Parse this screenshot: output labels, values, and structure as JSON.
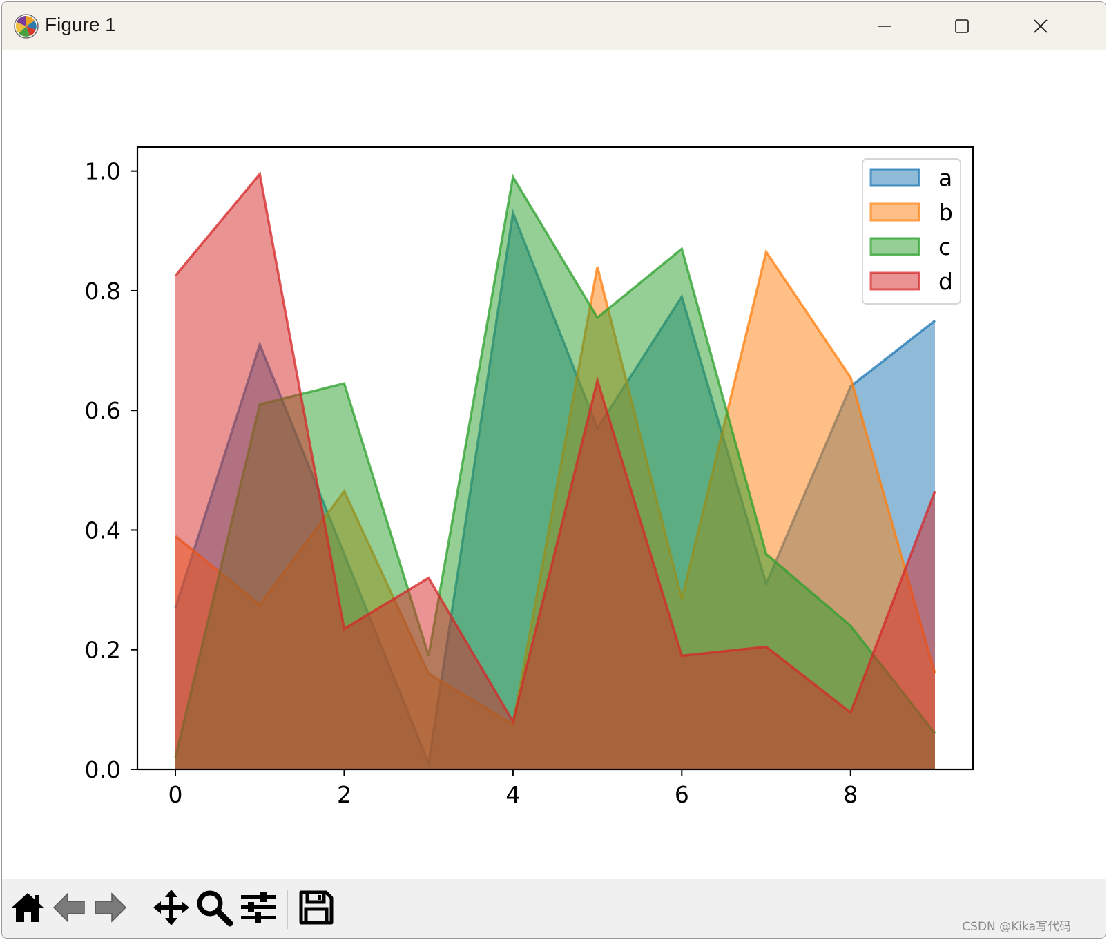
{
  "window": {
    "title": "Figure 1",
    "icons": [
      "matplotlib-icon",
      "minimize-icon",
      "maximize-icon",
      "close-icon"
    ]
  },
  "toolbar": {
    "buttons": [
      "home-icon",
      "back-icon",
      "forward-icon",
      "pan-icon",
      "zoom-icon",
      "configure-subplots-icon",
      "save-icon"
    ]
  },
  "watermark": "CSDN @Kika写代码",
  "chart_data": {
    "type": "area",
    "title": "",
    "xlabel": "",
    "ylabel": "",
    "x": [
      0,
      1,
      2,
      3,
      4,
      5,
      6,
      7,
      8,
      9
    ],
    "xlim": [
      -0.45,
      9.45
    ],
    "ylim": [
      0,
      1.04
    ],
    "xticks": [
      0,
      2,
      4,
      6,
      8
    ],
    "xtick_labels": [
      "0",
      "2",
      "4",
      "6",
      "8"
    ],
    "yticks": [
      0.0,
      0.2,
      0.4,
      0.6,
      0.8,
      1.0
    ],
    "ytick_labels": [
      "0.0",
      "0.2",
      "0.4",
      "0.6",
      "0.8",
      "1.0"
    ],
    "stacked": false,
    "alpha": 0.5,
    "grid": false,
    "legend_position": "top-right",
    "series": [
      {
        "name": "a",
        "color": "#1f77b4",
        "values": [
          0.27,
          0.71,
          0.36,
          0.01,
          0.93,
          0.57,
          0.79,
          0.31,
          0.64,
          0.75
        ]
      },
      {
        "name": "b",
        "color": "#ff7f0e",
        "values": [
          0.39,
          0.275,
          0.465,
          0.16,
          0.075,
          0.84,
          0.285,
          0.865,
          0.655,
          0.16
        ]
      },
      {
        "name": "c",
        "color": "#2ca02c",
        "values": [
          0.02,
          0.61,
          0.645,
          0.19,
          0.99,
          0.755,
          0.87,
          0.36,
          0.24,
          0.06
        ]
      },
      {
        "name": "d",
        "color": "#d62728",
        "values": [
          0.825,
          0.995,
          0.235,
          0.32,
          0.08,
          0.65,
          0.19,
          0.205,
          0.095,
          0.465
        ]
      }
    ]
  }
}
